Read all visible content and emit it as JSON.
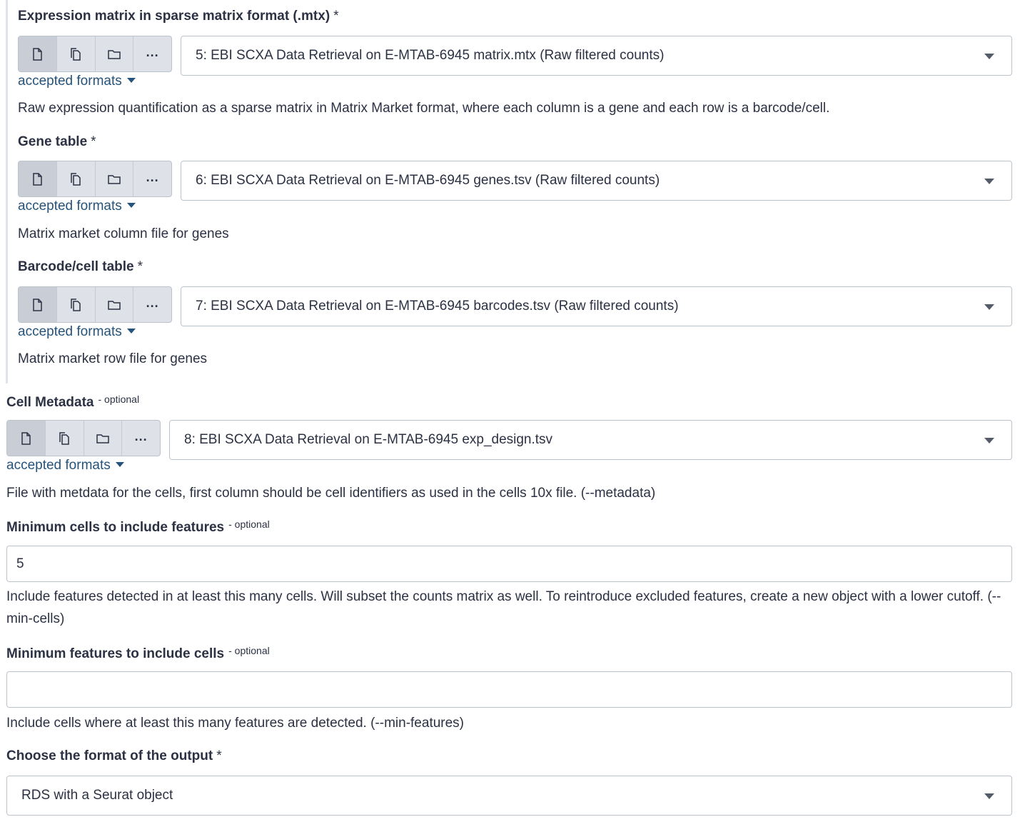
{
  "fields": [
    {
      "label": "Expression matrix in sparse matrix format (.mtx)",
      "required_marker": "*",
      "selected": "5: EBI SCXA Data Retrieval on E-MTAB-6945 matrix.mtx (Raw filtered counts)",
      "accepted_formats": "accepted formats",
      "help": "Raw expression quantification as a sparse matrix in Matrix Market format, where each column is a gene and each row is a barcode/cell."
    },
    {
      "label": "Gene table",
      "required_marker": "*",
      "selected": "6: EBI SCXA Data Retrieval on E-MTAB-6945 genes.tsv (Raw filtered counts)",
      "accepted_formats": "accepted formats",
      "help": "Matrix market column file for genes"
    },
    {
      "label": "Barcode/cell table",
      "required_marker": "*",
      "selected": "7: EBI SCXA Data Retrieval on E-MTAB-6945 barcodes.tsv (Raw filtered counts)",
      "accepted_formats": "accepted formats",
      "help": "Matrix market row file for genes"
    },
    {
      "label": "Cell Metadata",
      "optional_marker": "- optional",
      "selected": "8: EBI SCXA Data Retrieval on E-MTAB-6945 exp_design.tsv",
      "accepted_formats": "accepted formats",
      "help": "File with metdata for the cells, first column should be cell identifiers as used in the cells 10x file. (--metadata)"
    }
  ],
  "min_cells": {
    "label": "Minimum cells to include features",
    "optional_marker": "- optional",
    "value": "5",
    "help": "Include features detected in at least this many cells. Will subset the counts matrix as well. To reintroduce excluded features, create a new object with a lower cutoff. (--min-cells)"
  },
  "min_features": {
    "label": "Minimum features to include cells",
    "optional_marker": "- optional",
    "value": "",
    "help": "Include cells where at least this many features are detected. (--min-features)"
  },
  "output_format": {
    "label": "Choose the format of the output",
    "required_marker": "*",
    "selected": "RDS with a Seurat object"
  },
  "icons": [
    "file-icon",
    "files-icon",
    "folder-icon",
    "more-icon",
    "chevron-down-icon"
  ],
  "colors": {
    "link": "#25537b",
    "text": "#2c3143",
    "border": "#bcc3cd",
    "button_bg": "#dee2e8"
  }
}
